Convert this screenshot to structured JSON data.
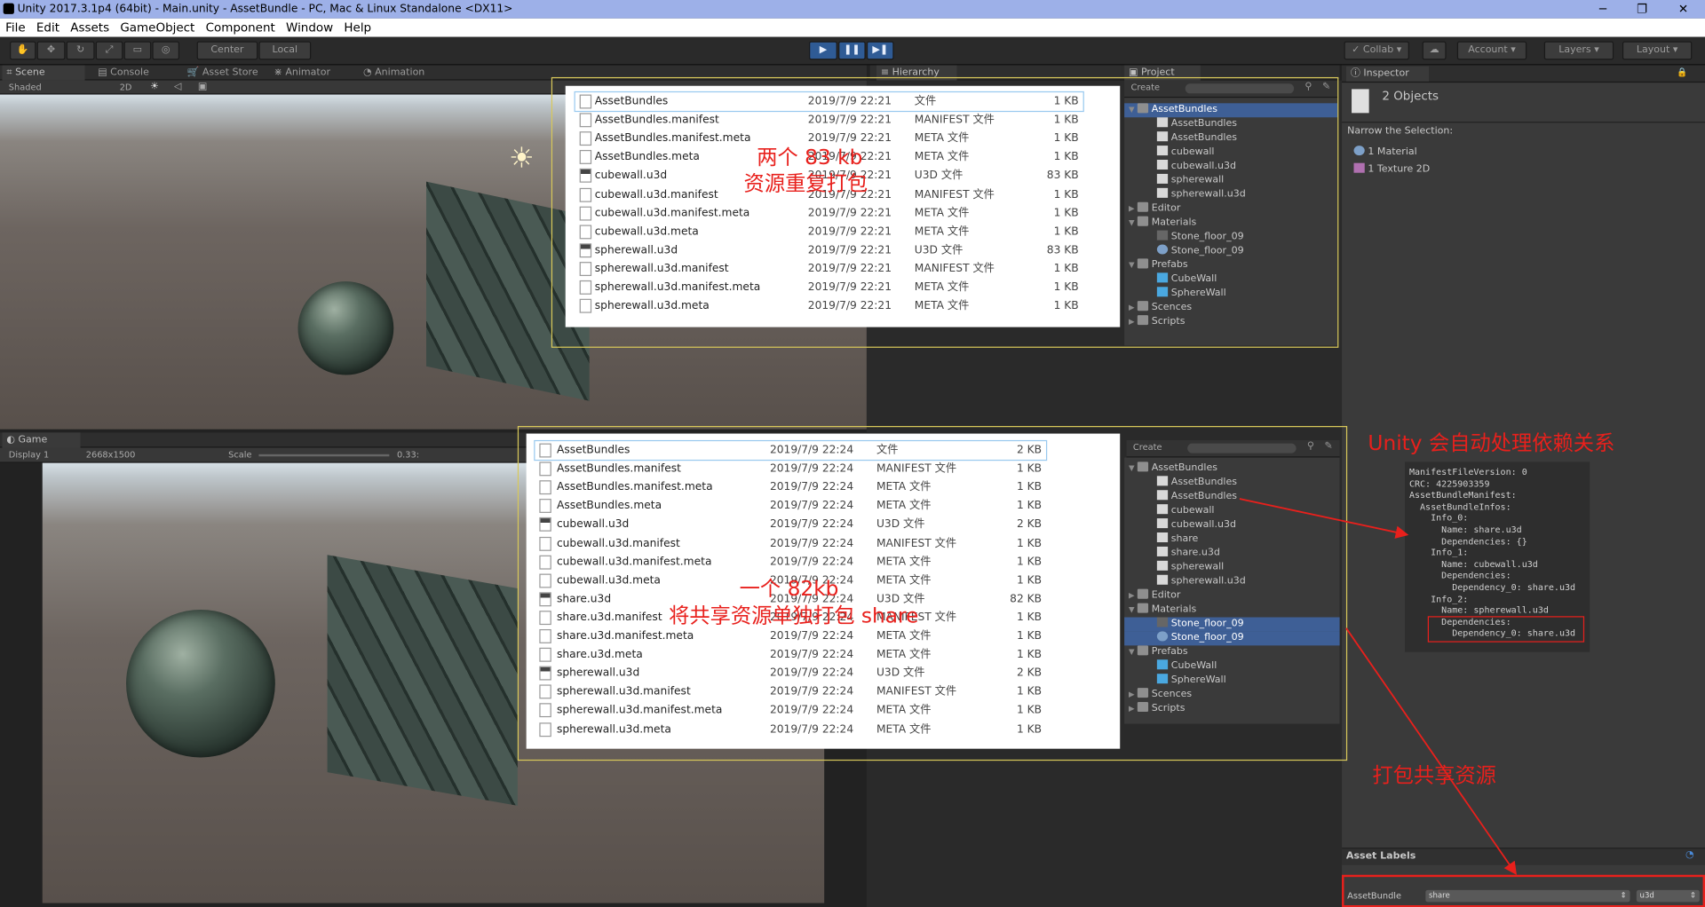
{
  "window": {
    "title": "Unity 2017.3.1p4 (64bit) - Main.unity - AssetBundle - PC, Mac & Linux Standalone <DX11>"
  },
  "menu": [
    "File",
    "Edit",
    "Assets",
    "GameObject",
    "Component",
    "Window",
    "Help"
  ],
  "toolbar": {
    "center": "Center",
    "local": "Local",
    "collab": "Collab",
    "account": "Account",
    "layers": "Layers",
    "layout": "Layout"
  },
  "scene": {
    "tabs": [
      "Scene",
      "Console",
      "Asset Store",
      "Animator",
      "Animation"
    ],
    "shading": "Shaded",
    "mode": "2D"
  },
  "game": {
    "tab": "Game",
    "display": "Display 1",
    "resolution": "2668x1500",
    "scale_label": "Scale",
    "scale_value": "0.33:"
  },
  "hierarchy": {
    "tab": "Hierarchy"
  },
  "project": {
    "tab": "Project",
    "create": "Create"
  },
  "inspector": {
    "tab": "Inspector",
    "objects": "2 Objects",
    "narrow": "Narrow the Selection:",
    "items": [
      "1 Material",
      "1 Texture 2D"
    ],
    "asset_labels": "Asset Labels",
    "asset_bundle_label": "AssetBundle",
    "bundle_name": "share",
    "variant": "u3d"
  },
  "explorer_top": {
    "files": [
      {
        "name": "AssetBundles",
        "date": "2019/7/9 22:21",
        "type": "文件",
        "size": "1 KB"
      },
      {
        "name": "AssetBundles.manifest",
        "date": "2019/7/9 22:21",
        "type": "MANIFEST 文件",
        "size": "1 KB"
      },
      {
        "name": "AssetBundles.manifest.meta",
        "date": "2019/7/9 22:21",
        "type": "META 文件",
        "size": "1 KB"
      },
      {
        "name": "AssetBundles.meta",
        "date": "2019/7/9 22:21",
        "type": "META 文件",
        "size": "1 KB"
      },
      {
        "name": "cubewall.u3d",
        "date": "2019/7/9 22:21",
        "type": "U3D 文件",
        "size": "83 KB"
      },
      {
        "name": "cubewall.u3d.manifest",
        "date": "2019/7/9 22:21",
        "type": "MANIFEST 文件",
        "size": "1 KB"
      },
      {
        "name": "cubewall.u3d.manifest.meta",
        "date": "2019/7/9 22:21",
        "type": "META 文件",
        "size": "1 KB"
      },
      {
        "name": "cubewall.u3d.meta",
        "date": "2019/7/9 22:21",
        "type": "META 文件",
        "size": "1 KB"
      },
      {
        "name": "spherewall.u3d",
        "date": "2019/7/9 22:21",
        "type": "U3D 文件",
        "size": "83 KB"
      },
      {
        "name": "spherewall.u3d.manifest",
        "date": "2019/7/9 22:21",
        "type": "MANIFEST 文件",
        "size": "1 KB"
      },
      {
        "name": "spherewall.u3d.manifest.meta",
        "date": "2019/7/9 22:21",
        "type": "META 文件",
        "size": "1 KB"
      },
      {
        "name": "spherewall.u3d.meta",
        "date": "2019/7/9 22:21",
        "type": "META 文件",
        "size": "1 KB"
      }
    ]
  },
  "explorer_bottom": {
    "files": [
      {
        "name": "AssetBundles",
        "date": "2019/7/9 22:24",
        "type": "文件",
        "size": "2 KB"
      },
      {
        "name": "AssetBundles.manifest",
        "date": "2019/7/9 22:24",
        "type": "MANIFEST 文件",
        "size": "1 KB"
      },
      {
        "name": "AssetBundles.manifest.meta",
        "date": "2019/7/9 22:24",
        "type": "META 文件",
        "size": "1 KB"
      },
      {
        "name": "AssetBundles.meta",
        "date": "2019/7/9 22:24",
        "type": "META 文件",
        "size": "1 KB"
      },
      {
        "name": "cubewall.u3d",
        "date": "2019/7/9 22:24",
        "type": "U3D 文件",
        "size": "2 KB"
      },
      {
        "name": "cubewall.u3d.manifest",
        "date": "2019/7/9 22:24",
        "type": "MANIFEST 文件",
        "size": "1 KB"
      },
      {
        "name": "cubewall.u3d.manifest.meta",
        "date": "2019/7/9 22:24",
        "type": "META 文件",
        "size": "1 KB"
      },
      {
        "name": "cubewall.u3d.meta",
        "date": "2019/7/9 22:24",
        "type": "META 文件",
        "size": "1 KB"
      },
      {
        "name": "share.u3d",
        "date": "2019/7/9 22:24",
        "type": "U3D 文件",
        "size": "82 KB"
      },
      {
        "name": "share.u3d.manifest",
        "date": "2019/7/9 22:24",
        "type": "MANIFEST 文件",
        "size": "1 KB"
      },
      {
        "name": "share.u3d.manifest.meta",
        "date": "2019/7/9 22:24",
        "type": "META 文件",
        "size": "1 KB"
      },
      {
        "name": "share.u3d.meta",
        "date": "2019/7/9 22:24",
        "type": "META 文件",
        "size": "1 KB"
      },
      {
        "name": "spherewall.u3d",
        "date": "2019/7/9 22:24",
        "type": "U3D 文件",
        "size": "2 KB"
      },
      {
        "name": "spherewall.u3d.manifest",
        "date": "2019/7/9 22:24",
        "type": "MANIFEST 文件",
        "size": "1 KB"
      },
      {
        "name": "spherewall.u3d.manifest.meta",
        "date": "2019/7/9 22:24",
        "type": "META 文件",
        "size": "1 KB"
      },
      {
        "name": "spherewall.u3d.meta",
        "date": "2019/7/9 22:24",
        "type": "META 文件",
        "size": "1 KB"
      }
    ]
  },
  "tree_top": [
    {
      "label": "AssetBundles",
      "icon": "folder",
      "depth": 0,
      "expanded": true,
      "selected": true
    },
    {
      "label": "AssetBundles",
      "icon": "file",
      "depth": 1
    },
    {
      "label": "AssetBundles",
      "icon": "file",
      "depth": 1
    },
    {
      "label": "cubewall",
      "icon": "file",
      "depth": 1
    },
    {
      "label": "cubewall.u3d",
      "icon": "file",
      "depth": 1
    },
    {
      "label": "spherewall",
      "icon": "file",
      "depth": 1
    },
    {
      "label": "spherewall.u3d",
      "icon": "file",
      "depth": 1
    },
    {
      "label": "Editor",
      "icon": "folder",
      "depth": 0,
      "expanded": false
    },
    {
      "label": "Materials",
      "icon": "folder",
      "depth": 0,
      "expanded": true
    },
    {
      "label": "Stone_floor_09",
      "icon": "tex",
      "depth": 1
    },
    {
      "label": "Stone_floor_09",
      "icon": "mat",
      "depth": 1
    },
    {
      "label": "Prefabs",
      "icon": "folder",
      "depth": 0,
      "expanded": true
    },
    {
      "label": "CubeWall",
      "icon": "cube",
      "depth": 1
    },
    {
      "label": "SphereWall",
      "icon": "cube",
      "depth": 1
    },
    {
      "label": "Scences",
      "icon": "folder",
      "depth": 0,
      "expanded": false
    },
    {
      "label": "Scripts",
      "icon": "folder",
      "depth": 0,
      "expanded": false
    }
  ],
  "tree_bottom": [
    {
      "label": "AssetBundles",
      "icon": "folder",
      "depth": 0,
      "expanded": true
    },
    {
      "label": "AssetBundles",
      "icon": "file",
      "depth": 1
    },
    {
      "label": "AssetBundles",
      "icon": "file",
      "depth": 1
    },
    {
      "label": "cubewall",
      "icon": "file",
      "depth": 1
    },
    {
      "label": "cubewall.u3d",
      "icon": "file",
      "depth": 1
    },
    {
      "label": "share",
      "icon": "file",
      "depth": 1
    },
    {
      "label": "share.u3d",
      "icon": "file",
      "depth": 1
    },
    {
      "label": "spherewall",
      "icon": "file",
      "depth": 1
    },
    {
      "label": "spherewall.u3d",
      "icon": "file",
      "depth": 1
    },
    {
      "label": "Editor",
      "icon": "folder",
      "depth": 0,
      "expanded": false
    },
    {
      "label": "Materials",
      "icon": "folder",
      "depth": 0,
      "expanded": true
    },
    {
      "label": "Stone_floor_09",
      "icon": "tex",
      "depth": 1,
      "selected": true
    },
    {
      "label": "Stone_floor_09",
      "icon": "mat",
      "depth": 1,
      "selected": true
    },
    {
      "label": "Prefabs",
      "icon": "folder",
      "depth": 0,
      "expanded": true
    },
    {
      "label": "CubeWall",
      "icon": "cube",
      "depth": 1
    },
    {
      "label": "SphereWall",
      "icon": "cube",
      "depth": 1
    },
    {
      "label": "Scences",
      "icon": "folder",
      "depth": 0,
      "expanded": false
    },
    {
      "label": "Scripts",
      "icon": "folder",
      "depth": 0,
      "expanded": false
    }
  ],
  "manifest_lines": [
    "ManifestFileVersion: 0",
    "CRC: 4225903359",
    "AssetBundleManifest:",
    "  AssetBundleInfos:",
    "    Info_0:",
    "      Name: share.u3d",
    "      Dependencies: {}",
    "    Info_1:",
    "      Name: cubewall.u3d",
    "      Dependencies:",
    "        Dependency_0: share.u3d",
    "    Info_2:",
    "      Name: spherewall.u3d",
    "      Dependencies:",
    "        Dependency_0: share.u3d"
  ],
  "annotations": {
    "top_line1": "两个 83 kb",
    "top_line2": "资源重复打包",
    "bottom_line1": "一个 82kb",
    "bottom_line2": "将共享资源单独打包 share",
    "unity_note": "Unity 会自动处理依赖关系",
    "pack_note": "打包共享资源"
  },
  "colors": {
    "annotation_red": "#e8201c",
    "selection_blue": "#3e5f96",
    "play_blue": "#2f5b95",
    "yellow_frame": "#d8c85a"
  }
}
